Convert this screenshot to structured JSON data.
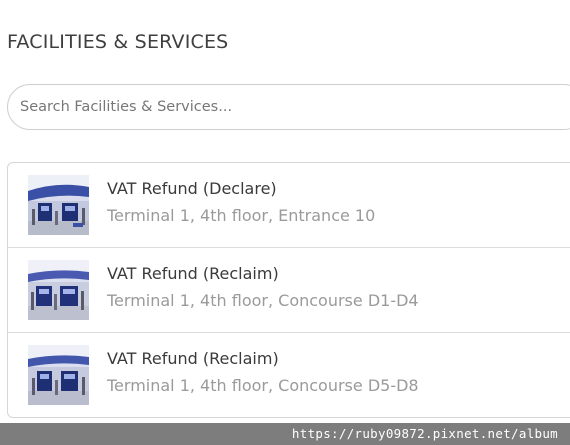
{
  "header": {
    "title": "FACILITIES & SERVICES"
  },
  "search": {
    "placeholder": "Search Facilities & Services..."
  },
  "facilities": [
    {
      "title": "VAT Refund (Declare)",
      "location": "Terminal 1, 4th floor, Entrance 10",
      "thumbnail_icon": "vat-refund-counter-photo"
    },
    {
      "title": "VAT Refund (Reclaim)",
      "location": "Terminal 1, 4th floor, Concourse D1-D4",
      "thumbnail_icon": "vat-refund-counter-photo"
    },
    {
      "title": "VAT Refund (Reclaim)",
      "location": "Terminal 1, 4th floor, Concourse D5-D8",
      "thumbnail_icon": "vat-refund-counter-photo"
    }
  ],
  "watermark": {
    "text": "https://ruby09872.pixnet.net/album"
  },
  "colors": {
    "title_text": "#3a3a3a",
    "subtitle_text": "#9a9a9a",
    "border": "#d6d6d6",
    "watermark_bg": "#7d7d7d"
  }
}
